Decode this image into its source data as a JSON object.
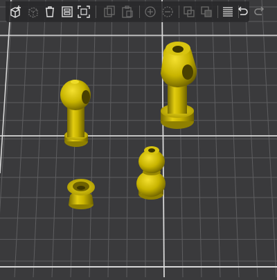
{
  "colors": {
    "bed_background": "#3a3a3c",
    "grid_line": "#5e5e60",
    "grid_line_major": "#d8d8d8",
    "model": "#c8b400",
    "toolbar_bg": "#2a2a2c",
    "icon_active": "#e6e6e6",
    "icon_disabled": "#6b6b6b"
  },
  "toolbar": {
    "buttons": [
      {
        "id": "add",
        "icon": "add-object-icon",
        "enabled": true
      },
      {
        "id": "delete",
        "icon": "delete-object-icon",
        "enabled": false
      },
      {
        "id": "delete-all",
        "icon": "trash-icon",
        "enabled": true
      },
      {
        "id": "arrange",
        "icon": "arrange-icon",
        "enabled": true
      },
      {
        "id": "split",
        "icon": "fit-view-icon",
        "enabled": true
      },
      {
        "id": "copy",
        "icon": "copy-icon",
        "enabled": false
      },
      {
        "id": "paste",
        "icon": "paste-icon",
        "enabled": false
      },
      {
        "id": "add-instance",
        "icon": "add-instance-icon",
        "enabled": false
      },
      {
        "id": "remove-instance",
        "icon": "remove-instance-icon",
        "enabled": false
      },
      {
        "id": "split-objects",
        "icon": "split-objects-icon",
        "enabled": false
      },
      {
        "id": "split-parts",
        "icon": "split-parts-icon",
        "enabled": false
      },
      {
        "id": "layers",
        "icon": "layers-icon",
        "enabled": true
      },
      {
        "id": "undo",
        "icon": "undo-icon",
        "enabled": true
      },
      {
        "id": "redo",
        "icon": "redo-icon",
        "enabled": false
      }
    ]
  },
  "scene": {
    "objects": [
      {
        "name": "ball-joint-tall-left"
      },
      {
        "name": "ball-joint-tall-right"
      },
      {
        "name": "socket-cup"
      },
      {
        "name": "double-ball-stack"
      }
    ]
  }
}
